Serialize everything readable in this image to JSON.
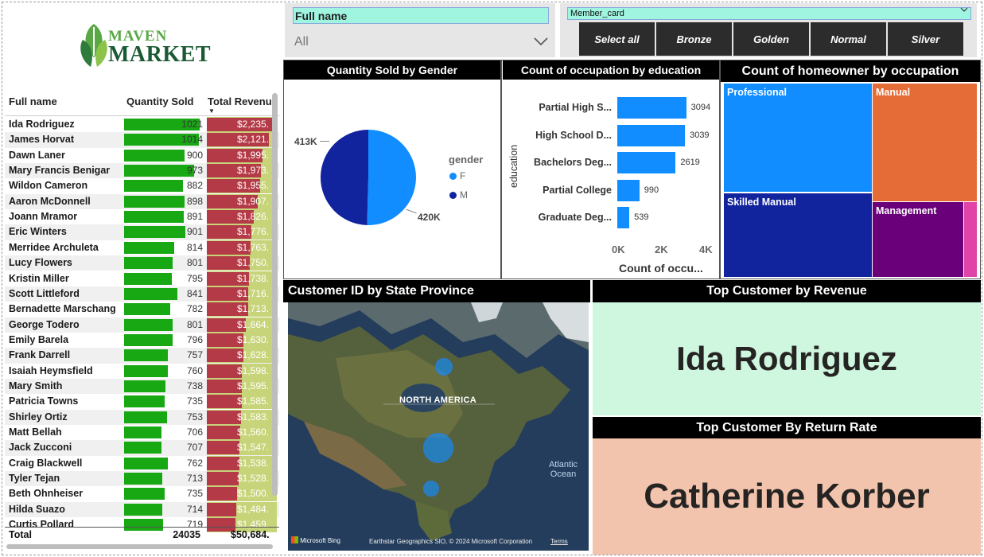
{
  "logo": {
    "line1": "MAVEN",
    "line2": "MARKET"
  },
  "table": {
    "headers": {
      "name": "Full name",
      "qty": "Quantity Sold",
      "rev": "Total Revenue"
    },
    "rows": [
      {
        "name": "Ida Rodriguez",
        "qty": "1021",
        "rev": "$2,235.",
        "q": 1021,
        "r": 2235
      },
      {
        "name": "James Horvat",
        "qty": "1014",
        "rev": "$2,121.",
        "q": 1014,
        "r": 2121
      },
      {
        "name": "Dawn Laner",
        "qty": "900",
        "rev": "$1,995.",
        "q": 900,
        "r": 1995
      },
      {
        "name": "Mary Francis Benigar",
        "qty": "973",
        "rev": "$1,973.",
        "q": 973,
        "r": 1973
      },
      {
        "name": "Wildon Cameron",
        "qty": "882",
        "rev": "$1,955.",
        "q": 882,
        "r": 1955
      },
      {
        "name": "Aaron McDonnell",
        "qty": "898",
        "rev": "$1,907.",
        "q": 898,
        "r": 1907
      },
      {
        "name": "Joann Mramor",
        "qty": "891",
        "rev": "$1,826.",
        "q": 891,
        "r": 1826
      },
      {
        "name": "Eric Winters",
        "qty": "901",
        "rev": "$1,776.",
        "q": 901,
        "r": 1776
      },
      {
        "name": "Merridee Archuleta",
        "qty": "814",
        "rev": "$1,763.",
        "q": 814,
        "r": 1763
      },
      {
        "name": "Lucy Flowers",
        "qty": "801",
        "rev": "$1,750.",
        "q": 801,
        "r": 1750
      },
      {
        "name": "Kristin Miller",
        "qty": "795",
        "rev": "$1,738.",
        "q": 795,
        "r": 1738
      },
      {
        "name": "Scott Littleford",
        "qty": "841",
        "rev": "$1,716.",
        "q": 841,
        "r": 1716
      },
      {
        "name": "Bernadette Marschang",
        "qty": "782",
        "rev": "$1,713.",
        "q": 782,
        "r": 1713
      },
      {
        "name": "George Todero",
        "qty": "801",
        "rev": "$1,664.",
        "q": 801,
        "r": 1664
      },
      {
        "name": "Emily Barela",
        "qty": "796",
        "rev": "$1,630.",
        "q": 796,
        "r": 1630
      },
      {
        "name": "Frank Darrell",
        "qty": "757",
        "rev": "$1,628.",
        "q": 757,
        "r": 1628
      },
      {
        "name": "Isaiah Heymsfield",
        "qty": "760",
        "rev": "$1,598.",
        "q": 760,
        "r": 1598
      },
      {
        "name": "Mary Smith",
        "qty": "738",
        "rev": "$1,595.",
        "q": 738,
        "r": 1595
      },
      {
        "name": "Patricia Towns",
        "qty": "735",
        "rev": "$1,585.",
        "q": 735,
        "r": 1585
      },
      {
        "name": "Shirley Ortiz",
        "qty": "753",
        "rev": "$1,583.",
        "q": 753,
        "r": 1583
      },
      {
        "name": "Matt Bellah",
        "qty": "706",
        "rev": "$1,560.",
        "q": 706,
        "r": 1560
      },
      {
        "name": "Jack Zucconi",
        "qty": "707",
        "rev": "$1,547.",
        "q": 707,
        "r": 1547
      },
      {
        "name": "Craig Blackwell",
        "qty": "762",
        "rev": "$1,538.",
        "q": 762,
        "r": 1538
      },
      {
        "name": "Tyler Tejan",
        "qty": "713",
        "rev": "$1,528.",
        "q": 713,
        "r": 1528
      },
      {
        "name": "Beth Ohnheiser",
        "qty": "735",
        "rev": "$1,500.",
        "q": 735,
        "r": 1500
      },
      {
        "name": "Hilda Suazo",
        "qty": "714",
        "rev": "$1,484.",
        "q": 714,
        "r": 1484
      },
      {
        "name": "Curtis Pollard",
        "qty": "719",
        "rev": "$1,459.",
        "q": 719,
        "r": 1459
      }
    ],
    "total": {
      "label": "Total",
      "qty": "24035",
      "rev": "$50,684."
    }
  },
  "slicer_name": {
    "title": "Full name",
    "value": "All"
  },
  "slicer_card": {
    "title": "Member_card",
    "buttons": [
      "Select all",
      "Bronze",
      "Golden",
      "Normal",
      "Silver"
    ]
  },
  "pie": {
    "title": "Quantity Sold by Gender",
    "legend_title": "gender",
    "label_m": "413K",
    "label_f": "420K"
  },
  "bar": {
    "title": "Count of occupation by education",
    "ylabel": "education",
    "xlabel": "Count of occu...",
    "ticks": [
      "0K",
      "2K",
      "4K"
    ]
  },
  "treemap": {
    "title": "Count of homeowner by occupation",
    "labels": [
      "Professional",
      "Manual",
      "Skilled Manual",
      "Management"
    ]
  },
  "map": {
    "title": "Customer ID by State Province",
    "label": "NORTH AMERICA",
    "ocean": "Atlantic Ocean",
    "attribution": "Earthstar Geographics SIO, © 2024 Microsoft Corporation",
    "terms": "Terms",
    "brand": "Microsoft Bing"
  },
  "cards": {
    "revenue_title": "Top Customer by Revenue",
    "revenue_value": "Ida Rodriguez",
    "return_title": "Top Customer By Return Rate",
    "return_value": "Catherine Korber"
  },
  "chart_data": [
    {
      "type": "pie",
      "title": "Quantity Sold by Gender",
      "legend_title": "gender",
      "categories": [
        "F",
        "M"
      ],
      "values": [
        420000,
        413000
      ],
      "colors": [
        "#118dff",
        "#12239e"
      ]
    },
    {
      "type": "bar",
      "title": "Count of occupation by education",
      "xlabel": "Count of occu...",
      "ylabel": "education",
      "categories": [
        "Partial High S...",
        "High School D...",
        "Bachelors Deg...",
        "Partial College",
        "Graduate Deg..."
      ],
      "values": [
        3094,
        3039,
        2619,
        990,
        539
      ],
      "xlim": [
        0,
        4000
      ],
      "color": "#118dff"
    },
    {
      "type": "treemap",
      "title": "Count of homeowner by occupation",
      "categories": [
        "Professional",
        "Manual",
        "Skilled Manual",
        "Management",
        ""
      ],
      "colors": [
        "#118dff",
        "#e66c37",
        "#12239e",
        "#6b007b",
        "#e044a7"
      ]
    }
  ]
}
